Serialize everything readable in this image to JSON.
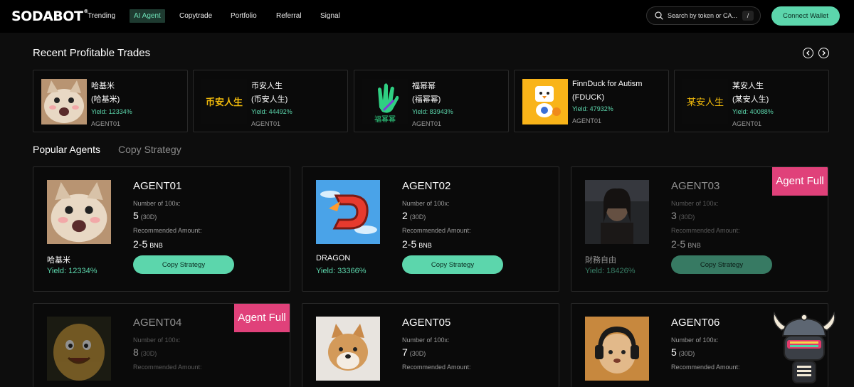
{
  "nav": {
    "logo": "SODABOT",
    "logo_mark": "®",
    "items": [
      "Trending",
      "AI Agent",
      "Copytrade",
      "Portfolio",
      "Referral",
      "Signal"
    ],
    "active": "AI Agent",
    "search_placeholder": "Search by token or CA...",
    "search_shortcut": "/",
    "connect_label": "Connect Wallet"
  },
  "recent": {
    "title": "Recent Profitable Trades",
    "trades": [
      {
        "name": "哈基米",
        "symbol": "(哈基米)",
        "yield": "Yield: 12334%",
        "agent": "AGENT01",
        "image": "cat-meme"
      },
      {
        "name": "币安人生",
        "symbol": "(币安人生)",
        "yield": "Yield: 44492%",
        "agent": "AGENT01",
        "image": "binance-life-logo",
        "image_text": "币安人生"
      },
      {
        "name": "福幂幂",
        "symbol": "(福幂幂)",
        "yield": "Yield: 83943%",
        "agent": "AGENT01",
        "image": "hand-logo",
        "image_text": "福幂幂"
      },
      {
        "name": "FinnDuck for Autism",
        "symbol": "(FDUCK)",
        "yield": "Yield: 47932%",
        "agent": "AGENT01",
        "image": "duck-logo"
      },
      {
        "name": "某安人生",
        "symbol": "(某安人生)",
        "yield": "Yield: 40088%",
        "agent": "AGENT01",
        "image": "text-logo",
        "image_text": "某安人生"
      }
    ]
  },
  "tabs": [
    "Popular Agents",
    "Copy Strategy"
  ],
  "agents": [
    {
      "name": "AGENT01",
      "label_100x": "Number of 100x:",
      "num_100x": "5",
      "period": "(30D)",
      "label_amount": "Recommended Amount:",
      "amount": "2-5",
      "unit": "BNB",
      "token": "哈基米",
      "yield": "Yield: 12334%",
      "full": false,
      "copy_label": "Copy Strategy",
      "image": "cat-meme"
    },
    {
      "name": "AGENT02",
      "label_100x": "Number of 100x:",
      "num_100x": "2",
      "period": "(30D)",
      "label_amount": "Recommended Amount:",
      "amount": "2-5",
      "unit": "BNB",
      "token": "DRAGON",
      "yield": "Yield: 33366%",
      "full": false,
      "copy_label": "Copy Strategy",
      "image": "dragon-logo"
    },
    {
      "name": "AGENT03",
      "label_100x": "Number of 100x:",
      "num_100x": "3",
      "period": "(30D)",
      "label_amount": "Recommended Amount:",
      "amount": "2-5",
      "unit": "BNB",
      "token": "財務自由",
      "yield": "Yield: 18426%",
      "full": true,
      "full_label": "Agent Full",
      "copy_label": "Copy Strategy",
      "image": "man-photo"
    },
    {
      "name": "AGENT04",
      "label_100x": "Number of 100x:",
      "num_100x": "8",
      "period": "(30D)",
      "label_amount": "Recommended Amount:",
      "full": true,
      "full_label": "Agent Full",
      "image": "potato-character"
    },
    {
      "name": "AGENT05",
      "label_100x": "Number of 100x:",
      "num_100x": "7",
      "period": "(30D)",
      "label_amount": "Recommended Amount:",
      "full": false,
      "image": "shiba-dog"
    },
    {
      "name": "AGENT06",
      "label_100x": "Number of 100x:",
      "num_100x": "5",
      "period": "(30D)",
      "label_amount": "Recommended Amount:",
      "full": false,
      "image": "cat-headphones"
    }
  ],
  "colors": {
    "accent": "#5cd6ac",
    "full_badge": "#e0417a",
    "bg": "#0d0d0d"
  },
  "mascot": "viking-bot-mascot"
}
